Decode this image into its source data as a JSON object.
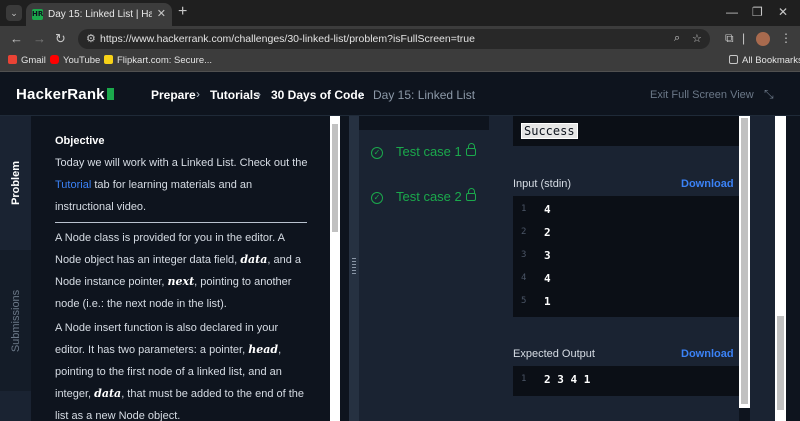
{
  "browser": {
    "tab_title": "Day 15: Linked List | HackerRank",
    "tab_favicon": "HR",
    "url": "https://www.hackerrank.com/challenges/30-linked-list/problem?isFullScreen=true",
    "bookmarks": [
      {
        "label": "Gmail",
        "color": "#ea4335"
      },
      {
        "label": "YouTube",
        "color": "#ff0000"
      },
      {
        "label": "Flipkart.com: Secure...",
        "color": "#f7d218"
      }
    ],
    "all_bookmarks": "All Bookmarks"
  },
  "header": {
    "logo": "HackerRank",
    "breadcrumbs": [
      "Prepare",
      "Tutorials",
      "30 Days of Code",
      "Day 15: Linked List"
    ],
    "exit_fullscreen": "Exit Full Screen View"
  },
  "side_tabs": {
    "problem": "Problem",
    "submissions": "Submissions"
  },
  "problem": {
    "objective_title": "Objective",
    "intro_before_link": "Today we will work with a Linked List. Check out the",
    "link_text": "Tutorial",
    "intro_after_link": "tab for learning materials and an instructional video.",
    "para2_a": "A Node class is provided for you in the editor. A Node object has an integer data field,",
    "para2_var1": "data",
    "para2_b": ", and a Node instance pointer,",
    "para2_var2": "next",
    "para2_c": ", pointing to another node (i.e.: the next node in the list).",
    "para3_a": "A Node insert function is also declared in your editor. It has two parameters: a pointer,",
    "para3_var1": "head",
    "para3_b": ", pointing to the first node of a linked list, and an integer,",
    "para3_var2": "data",
    "para3_c": ", that must be added to the end of the list as a new Node object."
  },
  "tests": [
    {
      "label": "Test case 1",
      "status": "passed"
    },
    {
      "label": "Test case 2",
      "status": "passed"
    }
  ],
  "output": {
    "status": "Success",
    "input_label": "Input (stdin)",
    "download": "Download",
    "input_lines": [
      {
        "no": "1",
        "value": "4"
      },
      {
        "no": "2",
        "value": "2"
      },
      {
        "no": "3",
        "value": "3"
      },
      {
        "no": "4",
        "value": "4"
      },
      {
        "no": "5",
        "value": "1"
      }
    ],
    "expected_label": "Expected Output",
    "expected_lines": [
      {
        "no": "1",
        "value": "2 3 4 1"
      }
    ]
  },
  "colors": {
    "accent_green": "#1ba94c",
    "link_blue": "#3b82f6",
    "bg_dark": "#0e141e",
    "panel": "#1a2332"
  }
}
